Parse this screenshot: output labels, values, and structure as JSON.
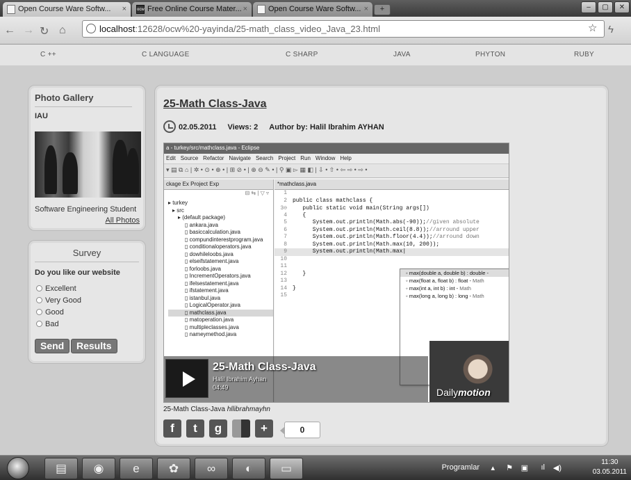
{
  "browser": {
    "tabs": [
      {
        "label": "Open Course Ware Softw...",
        "icon": "page-icon",
        "active": true
      },
      {
        "label": "Free Online Course Mater...",
        "icon": "ocw-icon",
        "active": false
      },
      {
        "label": "Open Course Ware Softw...",
        "icon": "page-icon",
        "active": false
      }
    ],
    "url_host": "localhost",
    "url_path": ":12628/ocw%20-yayinda/25-math_class_video_Java_23.html"
  },
  "site_nav": [
    "C ++",
    "C LANGUAGE",
    "C SHARP",
    "JAVA",
    "PHYTON",
    "RUBY"
  ],
  "gallery": {
    "title": "Photo Gallery",
    "subtitle": "IAU",
    "caption": "Software Engineering Student",
    "all_photos": "All Photos"
  },
  "survey": {
    "title": "Survey",
    "question": "Do you like our website",
    "options": [
      "Excellent",
      "Very Good",
      "Good",
      "Bad"
    ],
    "send": "Send",
    "results": "Results"
  },
  "article": {
    "title": "25-Math Class-Java",
    "date": "02.05.2011",
    "views": "Views: 2",
    "author": "Author by: Halil Ibrahim AYHAN"
  },
  "video": {
    "ide_title": "a - turkey/src/mathclass.java - Eclipse",
    "ide_menu": [
      "Edit",
      "Source",
      "Refactor",
      "Navigate",
      "Search",
      "Project",
      "Run",
      "Window",
      "Help"
    ],
    "explorer_tabs": "ckage Ex  Project Exp",
    "editor_tab": "*mathclass.java",
    "tree": [
      "turkey",
      "src",
      "(default package)",
      "ankara.java",
      "basiccalculation.java",
      "compundinterestprogram.java",
      "conditionaloperators.java",
      "dowhileloobs.java",
      "elseifstatement.java",
      "forloobs.java",
      "IncrementOperators.java",
      "ifelsestatement.java",
      "ifstatement.java",
      "istanbul.java",
      "LogicalOperator.java",
      "mathclass.java",
      "matoperation.java",
      "multipleclasses.java",
      "nameymethod.java"
    ],
    "code": [
      {
        "ln": "1",
        "text": "",
        "comment": ""
      },
      {
        "ln": "2",
        "text": "public class mathclass {",
        "comment": ""
      },
      {
        "ln": "3⊖",
        "text": "   public static void main(String args[])",
        "comment": ""
      },
      {
        "ln": "4",
        "text": "   {",
        "comment": ""
      },
      {
        "ln": "5",
        "text": "      System.out.println(Math.abs(-90));",
        "comment": "//given absolute"
      },
      {
        "ln": "6",
        "text": "      System.out.println(Math.ceil(8.8));",
        "comment": "//arround upper"
      },
      {
        "ln": "7",
        "text": "      System.out.println(Math.floor(4.4));",
        "comment": "//arround down"
      },
      {
        "ln": "8",
        "text": "      System.out.println(Math.max(10, 200));",
        "comment": ""
      },
      {
        "ln": "9",
        "text": "      System.out.println(Math.max|",
        "comment": ""
      },
      {
        "ln": "10",
        "text": "",
        "comment": ""
      },
      {
        "ln": "11",
        "text": "",
        "comment": ""
      },
      {
        "ln": "12",
        "text": "   }",
        "comment": ""
      },
      {
        "ln": "13",
        "text": "",
        "comment": ""
      },
      {
        "ln": "14",
        "text": "}",
        "comment": ""
      },
      {
        "ln": "15",
        "text": "",
        "comment": ""
      }
    ],
    "assist": [
      {
        "sig": "max(double a, double b) : double - ",
        "cls": ""
      },
      {
        "sig": "max(float a, float b) : float - ",
        "cls": "Math"
      },
      {
        "sig": "max(int a, int b) : int - ",
        "cls": "Math"
      },
      {
        "sig": "max(long a, long b) : long - ",
        "cls": "Math"
      }
    ],
    "overlay_title": "25-Math Class-Java",
    "overlay_author": "Halil Ibrahim Ayhan",
    "overlay_duration": "04:49",
    "brand": "Daily",
    "brand_bold": "motion"
  },
  "video_caption": {
    "link": "25-Math Class-Java",
    "author": "hllibrahmayhn"
  },
  "social": {
    "count": "0",
    "icons": [
      "facebook-icon",
      "twitter-icon",
      "google-plus-icon",
      "delicious-icon",
      "share-plus-icon"
    ]
  },
  "taskbar": {
    "programs_label": "Programlar",
    "time": "11:30",
    "date": "03.05.2011"
  }
}
